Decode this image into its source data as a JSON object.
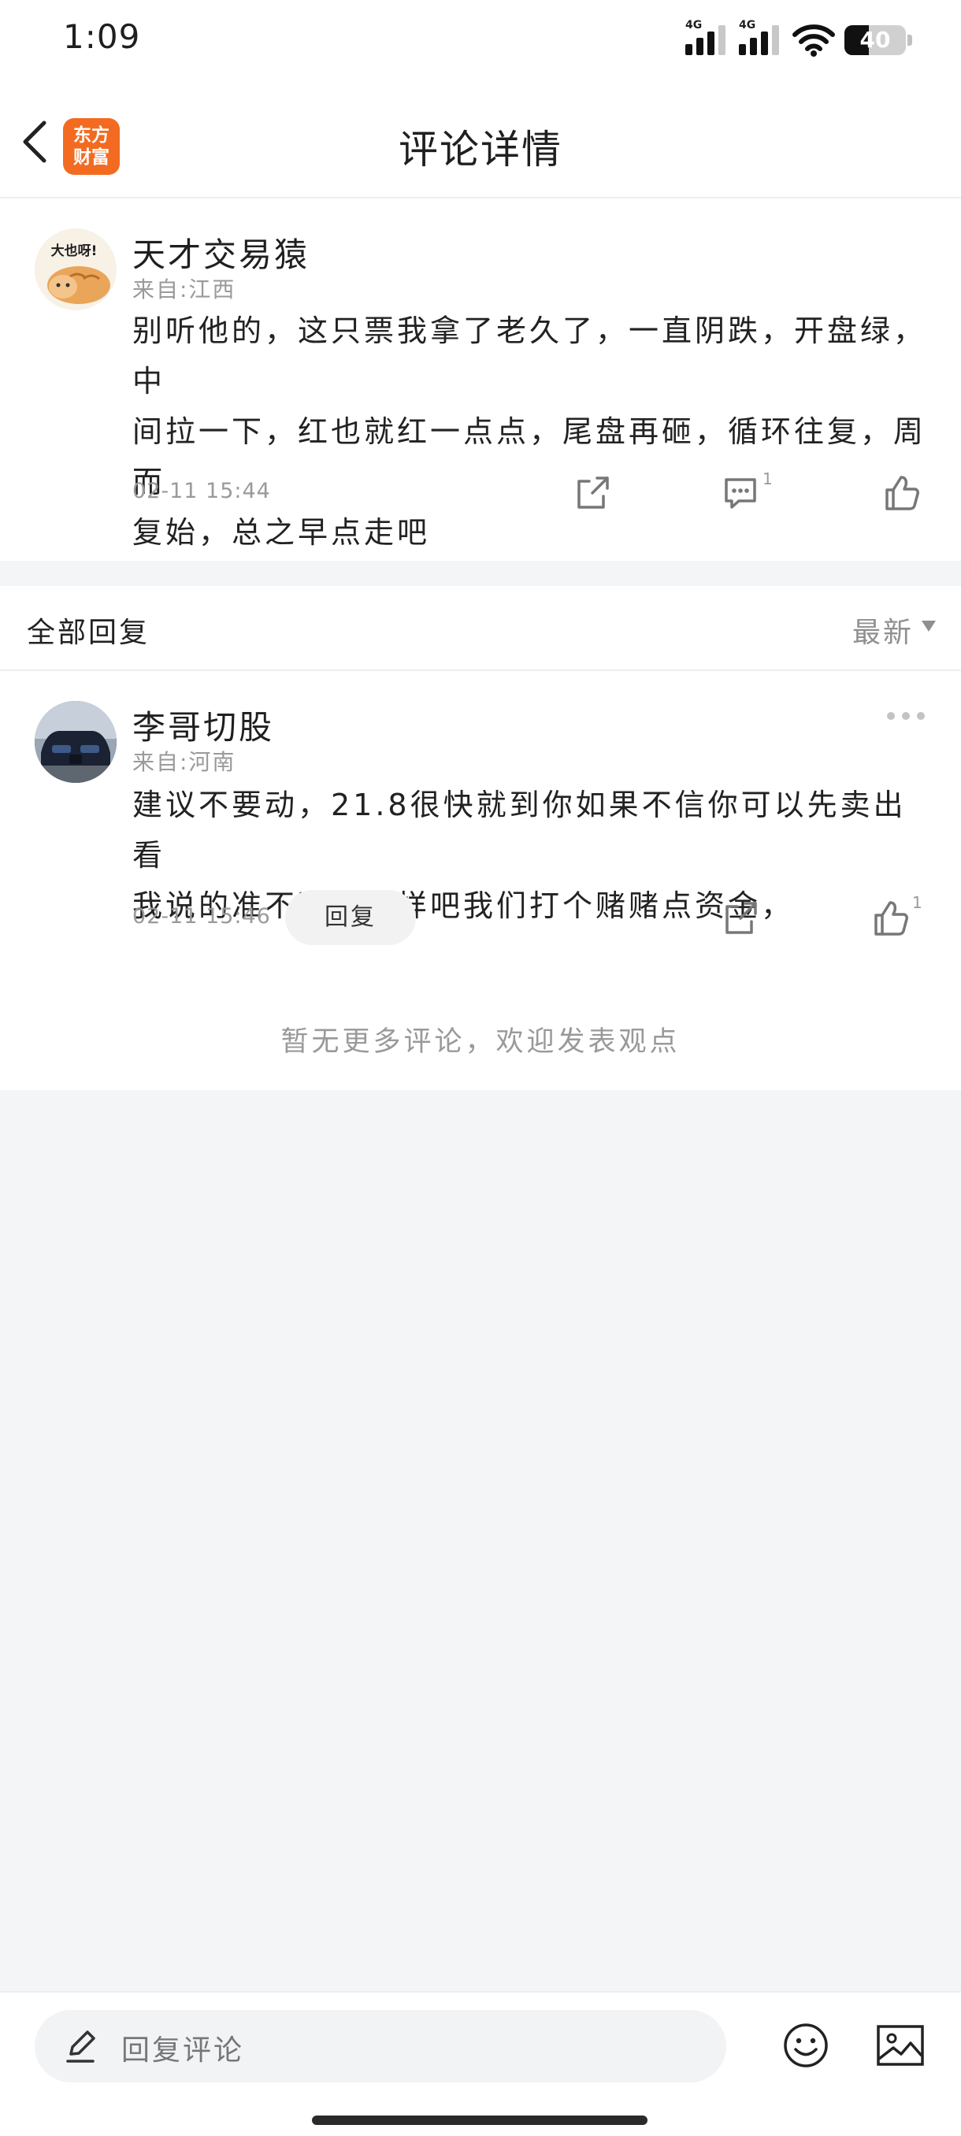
{
  "status_bar": {
    "time": "1:09",
    "signal_1_label": "4G",
    "signal_2_label": "4G",
    "battery_percent": "40",
    "battery_level": 0.4
  },
  "header": {
    "title": "评论详情",
    "logo_line1": "东方",
    "logo_line2": "财富"
  },
  "main_comment": {
    "username": "天才交易猿",
    "location": "来自:江西",
    "lines": [
      "别听他的，这只票我拿了老久了，一直阴跌，开盘绿，中",
      "间拉一下，红也就红一点点，尾盘再砸，循环往复，周而",
      "复始，总之早点走吧"
    ],
    "timestamp": "02-11 15:44",
    "comment_count": "1",
    "avatar_text": "大也呀!"
  },
  "replies": {
    "title": "全部回复",
    "sort_label": "最新",
    "items": [
      {
        "username": "李哥切股",
        "location": "来自:河南",
        "lines": [
          "建议不要动，21.8很快就到你如果不信你可以先卖出看",
          "我说的准不准，这样吧我们打个赌赌点资金，"
        ],
        "timestamp": "02-11 15:46",
        "reply_label": "回复",
        "like_count": "1"
      }
    ],
    "end_text": "暂无更多评论，欢迎发表观点"
  },
  "bottom_bar": {
    "input_placeholder": "回复评论"
  },
  "colors": {
    "brand_orange": "#f26b21",
    "page_bg": "#f4f5f7",
    "muted_text": "#9a9a9a"
  }
}
